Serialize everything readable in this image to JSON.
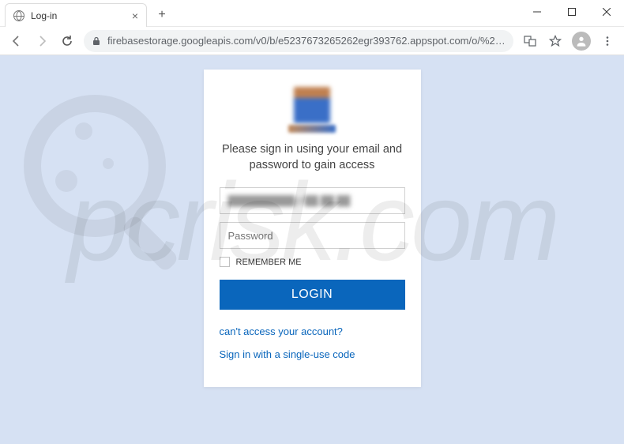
{
  "window": {
    "tab_title": "Log-in",
    "address": "firebasestorage.googleapis.com/v0/b/e5237673265262egr393762.appspot.com/o/%23%23%40%40%23%24%25…"
  },
  "login": {
    "instruction": "Please sign in using your email and password to gain access",
    "email_value": "██████████@██.██.██",
    "password_placeholder": "Password",
    "remember_label": "REMEMBER ME",
    "button_label": "LOGIN",
    "link_forgot": "can't access your account?",
    "link_single_use": "Sign in with a single-use code"
  },
  "watermark": {
    "text": "pcrisk.com"
  }
}
